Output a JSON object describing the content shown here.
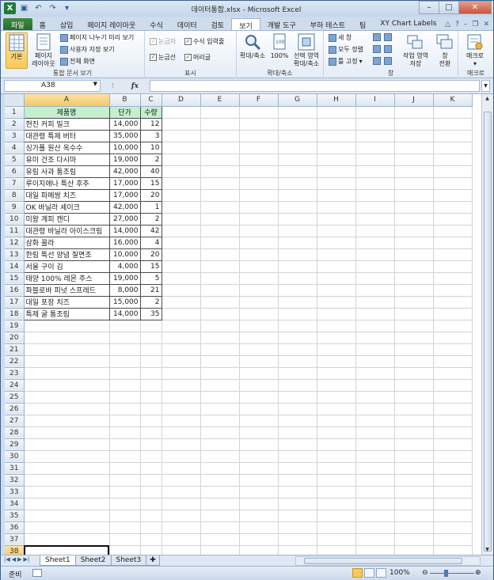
{
  "window": {
    "title": "데이터통합.xlsx - Microsoft Excel"
  },
  "ribbon_tabs": [
    "파일",
    "홈",
    "삽입",
    "페이지 레이아웃",
    "수식",
    "데이터",
    "검토",
    "보기",
    "개발 도구",
    "부하 테스트",
    "팀",
    "XY Chart Labels"
  ],
  "active_tab": "보기",
  "ribbon": {
    "workbook_views": {
      "normal": "기본",
      "page_layout_line1": "페이지",
      "page_layout_line2": "레이아웃",
      "page_break": "페이지 나누기 미리 보기",
      "custom_views": "사용자 지정 보기",
      "full_screen": "전체 화면",
      "label": "통합 문서 보기"
    },
    "show": {
      "ruler": "눈금자",
      "formula_bar": "수식 입력줄",
      "gridlines": "눈금선",
      "headings": "머리글",
      "label": "표시"
    },
    "zoom": {
      "zoom": "확대/축소",
      "hundred": "100%",
      "selection_line1": "선택 영역",
      "selection_line2": "확대/축소",
      "label": "확대/축소"
    },
    "window": {
      "new_window": "새 창",
      "arrange_all": "모두 정렬",
      "freeze": "틀 고정",
      "save_workspace_line1": "작업 영역",
      "save_workspace_line2": "저장",
      "switch_line1": "창",
      "switch_line2": "전환",
      "label": "창"
    },
    "macros": {
      "macro": "매크로",
      "label": "매크로"
    }
  },
  "formula_bar": {
    "name_box": "A38",
    "fx": "fx",
    "content": ""
  },
  "columns": [
    "A",
    "B",
    "C",
    "D",
    "E",
    "F",
    "G",
    "H",
    "I",
    "J",
    "K"
  ],
  "header_row": [
    "제품명",
    "단가",
    "수량"
  ],
  "rows": [
    [
      "현진 커피 밀크",
      "14,000",
      "12"
    ],
    [
      "대관령 특제 버터",
      "35,000",
      "3"
    ],
    [
      "싱가폴 원산 옥수수",
      "10,000",
      "10"
    ],
    [
      "유미 건조 다시마",
      "19,000",
      "2"
    ],
    [
      "유림 사과 통조림",
      "42,000",
      "40"
    ],
    [
      "루이지애나 특산 후추",
      "17,000",
      "15"
    ],
    [
      "대일 파메쌍 치즈",
      "17,000",
      "20"
    ],
    [
      "OK 바닐라 셰이크",
      "42,000",
      "1"
    ],
    [
      "미왕 계피 캔디",
      "27,000",
      "2"
    ],
    [
      "대관령 바닐라 아이스크림",
      "14,000",
      "42"
    ],
    [
      "삼화 콜라",
      "16,000",
      "4"
    ],
    [
      "한림 특선 양념 칠면조",
      "10,000",
      "20"
    ],
    [
      "서울 구이 김",
      "4,000",
      "15"
    ],
    [
      "태양 100% 레몬 주스",
      "19,000",
      "5"
    ],
    [
      "파블로바 피넛 스프레드",
      "8,000",
      "21"
    ],
    [
      "대일 포장 치즈",
      "15,000",
      "2"
    ],
    [
      "특제 굴 통조림",
      "14,000",
      "35"
    ]
  ],
  "row_numbers": [
    "1",
    "2",
    "3",
    "4",
    "5",
    "6",
    "7",
    "8",
    "9",
    "10",
    "11",
    "12",
    "13",
    "14",
    "15",
    "16",
    "17",
    "18",
    "19",
    "20",
    "21",
    "22",
    "23",
    "24",
    "25",
    "26",
    "27",
    "28",
    "29",
    "30",
    "31",
    "32",
    "33",
    "34",
    "35",
    "36",
    "37",
    "38"
  ],
  "sheets": [
    "Sheet1",
    "Sheet2",
    "Sheet3"
  ],
  "active_sheet": "Sheet1",
  "status": {
    "mode": "준비",
    "zoom": "100%"
  }
}
